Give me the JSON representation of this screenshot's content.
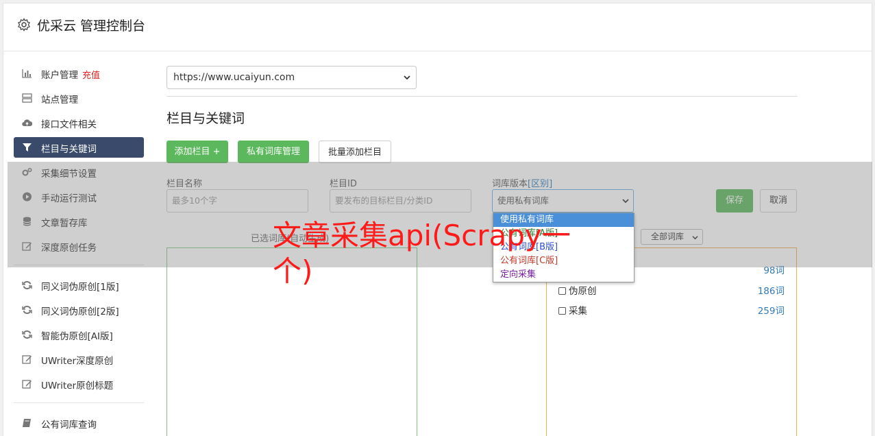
{
  "app": {
    "title": "优采云 管理控制台",
    "icon": "gear-icon"
  },
  "sidebar": {
    "recharge": "充值",
    "group1": [
      {
        "label": "账户管理",
        "icon": "bar-chart-icon"
      },
      {
        "label": "站点管理",
        "icon": "server-icon"
      },
      {
        "label": "接口文件相关",
        "icon": "cloud-upload-icon"
      },
      {
        "label": "栏目与关键词",
        "icon": "filter-icon",
        "active": true
      },
      {
        "label": "采集细节设置",
        "icon": "gears-icon"
      },
      {
        "label": "手动运行测试",
        "icon": "play-icon"
      },
      {
        "label": "文章暂存库",
        "icon": "database-icon"
      },
      {
        "label": "深度原创任务",
        "icon": "edit-icon"
      }
    ],
    "group2": [
      {
        "label": "同义词伪原创[1版]",
        "icon": "refresh-icon"
      },
      {
        "label": "同义词伪原创[2版]",
        "icon": "refresh-icon"
      },
      {
        "label": "智能伪原创[AI版]",
        "icon": "refresh-icon"
      },
      {
        "label": "UWriter深度原创",
        "icon": "edit-icon"
      },
      {
        "label": "UWriter原创标题",
        "icon": "edit-icon"
      }
    ],
    "group3": [
      {
        "label": "公有词库查询",
        "icon": "book-icon"
      }
    ]
  },
  "main": {
    "site_select_value": "https://www.ucaiyun.com",
    "section_title": "栏目与关键词",
    "buttons": {
      "add": "添加栏目 +",
      "private": "私有词库管理",
      "batch": "批量添加栏目"
    },
    "form": {
      "name_label": "栏目名称",
      "name_placeholder": "最多10个字",
      "id_label": "栏目ID",
      "id_placeholder": "要发布的目标栏目/分类ID",
      "version_label": "词库版本",
      "version_link": "[区别]",
      "version_value": "使用私有词库",
      "save": "保存",
      "cancel": "取消"
    },
    "selected_label": "已选词库(自动生成)",
    "lib_filter": "全部词库",
    "libraries": [
      {
        "name": "",
        "count": "98词"
      },
      {
        "name": "伪原创",
        "count": "186词"
      },
      {
        "name": "采集",
        "count": "259词"
      }
    ],
    "dropdown_options": [
      "使用私有词库",
      "公有词库[A版]",
      "公有词库[B版]",
      "公有词库[C版]",
      "定向采集"
    ]
  },
  "watermark": "文章采集api(Scrapy一个)"
}
